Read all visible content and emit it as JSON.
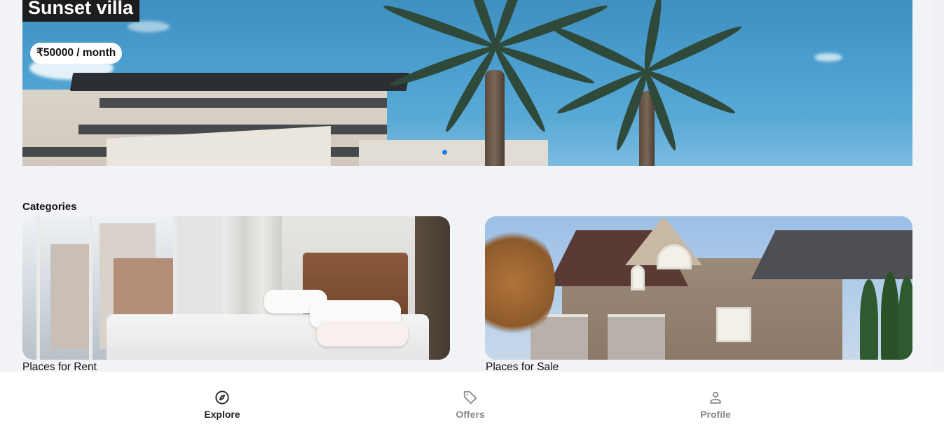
{
  "hero": {
    "title": "Sunset villa",
    "price": "₹50000 / month",
    "active_dot_color": "#1e7fe8"
  },
  "categories": {
    "heading": "Categories",
    "items": [
      {
        "label": "Places for Rent"
      },
      {
        "label": "Places for Sale"
      }
    ]
  },
  "nav": {
    "items": [
      {
        "label": "Explore",
        "icon": "compass-icon",
        "active": true
      },
      {
        "label": "Offers",
        "icon": "tag-icon",
        "active": false
      },
      {
        "label": "Profile",
        "icon": "person-icon",
        "active": false
      }
    ],
    "active_color": "#222222",
    "inactive_color": "#8a8a8a"
  }
}
